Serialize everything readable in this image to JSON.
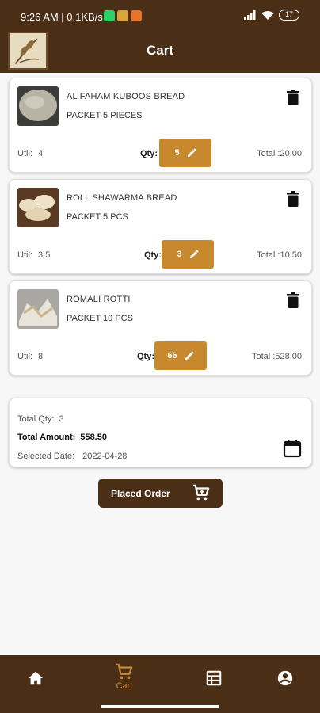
{
  "status_bar": {
    "time": "9:26 AM | 0.1KB/s",
    "battery": "17"
  },
  "app_bar": {
    "title": "Cart"
  },
  "cart_items": [
    {
      "name": "AL  FAHAM KUBOOS BREAD",
      "pack": "PACKET 5 PIECES",
      "util_label": "Util:",
      "util_value": "4",
      "qty_label": "Qty:",
      "qty": "5",
      "total": "Total :20.00"
    },
    {
      "name": "ROLL SHAWARMA BREAD",
      "pack": "PACKET 5 PCS",
      "util_label": "Util:",
      "util_value": "3.5",
      "qty_label": "Qty:",
      "qty": "3",
      "total": "Total :10.50"
    },
    {
      "name": "ROMALI ROTTI",
      "pack": "PACKET 10 PCS",
      "util_label": "Util:",
      "util_value": "8",
      "qty_label": "Qty:",
      "qty": "66",
      "total": "Total :528.00"
    }
  ],
  "summary": {
    "total_qty_label": "Total Qty:",
    "total_qty": "3",
    "total_amount_label": "Total Amount:",
    "total_amount": "558.50",
    "selected_date_label": "Selected Date:",
    "selected_date": "2022-04-28"
  },
  "order_button": {
    "label": "Placed Order"
  },
  "bottom_nav": {
    "cart_label": "Cart"
  },
  "colors": {
    "primary": "#4b2e16",
    "accent": "#c8882e"
  },
  "icons": [
    "home-icon",
    "cart-icon",
    "catalog-icon",
    "account-icon",
    "trash-icon",
    "edit-icon",
    "calendar-icon"
  ]
}
